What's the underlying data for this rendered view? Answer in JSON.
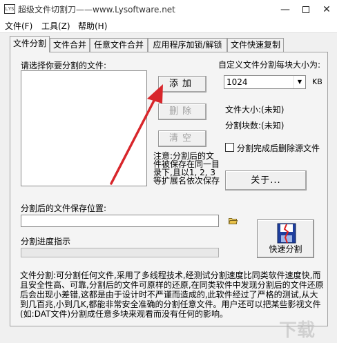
{
  "window": {
    "app_icon_text": "LYS",
    "title": "超级文件切割刀——www.Lysoftware.net",
    "minimize_glyph": "—",
    "close_glyph": "✕"
  },
  "menu": [
    "文件(F)",
    "工具(Z)",
    "帮助(H)"
  ],
  "tabs": [
    {
      "label": "文件分割",
      "active": true
    },
    {
      "label": "文件合并",
      "active": false
    },
    {
      "label": "任意文件合并",
      "active": false
    },
    {
      "label": "应用程序加锁/解锁",
      "active": false
    },
    {
      "label": "文件快速复制",
      "active": false
    }
  ],
  "split": {
    "file_list_label": "请选择你要分割的文件:",
    "add_button": "添加",
    "delete_button": "删除",
    "clear_button": "清空",
    "chunk_size_label": "自定义文件分割每块大小为:",
    "chunk_size_value": "1024",
    "chunk_unit": "KB",
    "file_size_label": "文件大小:(未知)",
    "chunk_count_label": "分割块数:(未知)",
    "delete_source_label": "分割完成后删除源文件",
    "about_button": "关于...",
    "note": "注意:分割后的文件被保存在同一目录下,且以1, 2, 3等扩展名依次保存",
    "save_location_label": "分割后的文件保存位置:",
    "save_location_value": "",
    "progress_label": "分割进度指示",
    "progress_fraction": 0,
    "quick_split_button": "快速分割",
    "description": "文件分割:可分割任何文件,采用了多线程技术,经测试分割速度比同类软件速度快,而且安全性高、可靠,分割后的文件可原样的还原,在同类软件中发现分割后的文件还原后会出现小差错,这都是由于设计时不严谨而造成的,此软件经过了严格的测试,从大到几百兆,小到几K,都能非常安全准确的分割任意文件。用户还可以把某些影视文件(如:DAT文件)分割成任意多块来观看而没有任何的影响。"
  },
  "watermark": "下载"
}
